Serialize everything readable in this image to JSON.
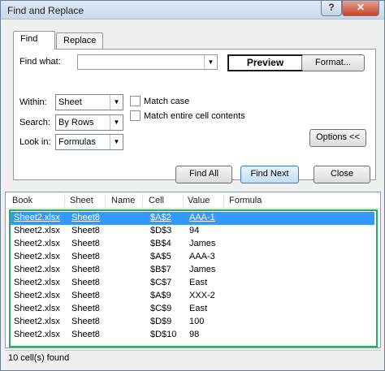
{
  "window": {
    "title": "Find and Replace",
    "help_label": "?",
    "close_label": "✕"
  },
  "tabs": [
    {
      "label": "Find",
      "active": true
    },
    {
      "label": "Replace",
      "active": false
    }
  ],
  "find": {
    "find_what_label": "Find what:",
    "find_what_value": "",
    "preview_label": "Preview",
    "format_label": "Format...",
    "within_label": "Within:",
    "within_value": "Sheet",
    "search_label": "Search:",
    "search_value": "By Rows",
    "look_in_label": "Look in:",
    "look_in_value": "Formulas",
    "match_case_label": "Match case",
    "match_entire_label": "Match entire cell contents",
    "options_label": "Options <<"
  },
  "buttons": {
    "find_all": "Find All",
    "find_next": "Find Next",
    "close": "Close"
  },
  "results": {
    "columns": [
      "Book",
      "Sheet",
      "Name",
      "Cell",
      "Value",
      "Formula"
    ],
    "rows": [
      {
        "book": "Sheet2.xlsx",
        "sheet": "Sheet8",
        "name": "",
        "cell": "$A$2",
        "value": "AAA-1",
        "formula": "",
        "selected": true
      },
      {
        "book": "Sheet2.xlsx",
        "sheet": "Sheet8",
        "name": "",
        "cell": "$D$3",
        "value": "94",
        "formula": ""
      },
      {
        "book": "Sheet2.xlsx",
        "sheet": "Sheet8",
        "name": "",
        "cell": "$B$4",
        "value": "James",
        "formula": ""
      },
      {
        "book": "Sheet2.xlsx",
        "sheet": "Sheet8",
        "name": "",
        "cell": "$A$5",
        "value": "AAA-3",
        "formula": ""
      },
      {
        "book": "Sheet2.xlsx",
        "sheet": "Sheet8",
        "name": "",
        "cell": "$B$7",
        "value": "James",
        "formula": ""
      },
      {
        "book": "Sheet2.xlsx",
        "sheet": "Sheet8",
        "name": "",
        "cell": "$C$7",
        "value": "East",
        "formula": ""
      },
      {
        "book": "Sheet2.xlsx",
        "sheet": "Sheet8",
        "name": "",
        "cell": "$A$9",
        "value": "XXX-2",
        "formula": ""
      },
      {
        "book": "Sheet2.xlsx",
        "sheet": "Sheet8",
        "name": "",
        "cell": "$C$9",
        "value": "East",
        "formula": ""
      },
      {
        "book": "Sheet2.xlsx",
        "sheet": "Sheet8",
        "name": "",
        "cell": "$D$9",
        "value": "100",
        "formula": ""
      },
      {
        "book": "Sheet2.xlsx",
        "sheet": "Sheet8",
        "name": "",
        "cell": "$D$10",
        "value": "98",
        "formula": ""
      }
    ],
    "status": "10 cell(s) found"
  },
  "colors": {
    "selection": "#3399ff",
    "highlight_border": "#1db45b"
  }
}
